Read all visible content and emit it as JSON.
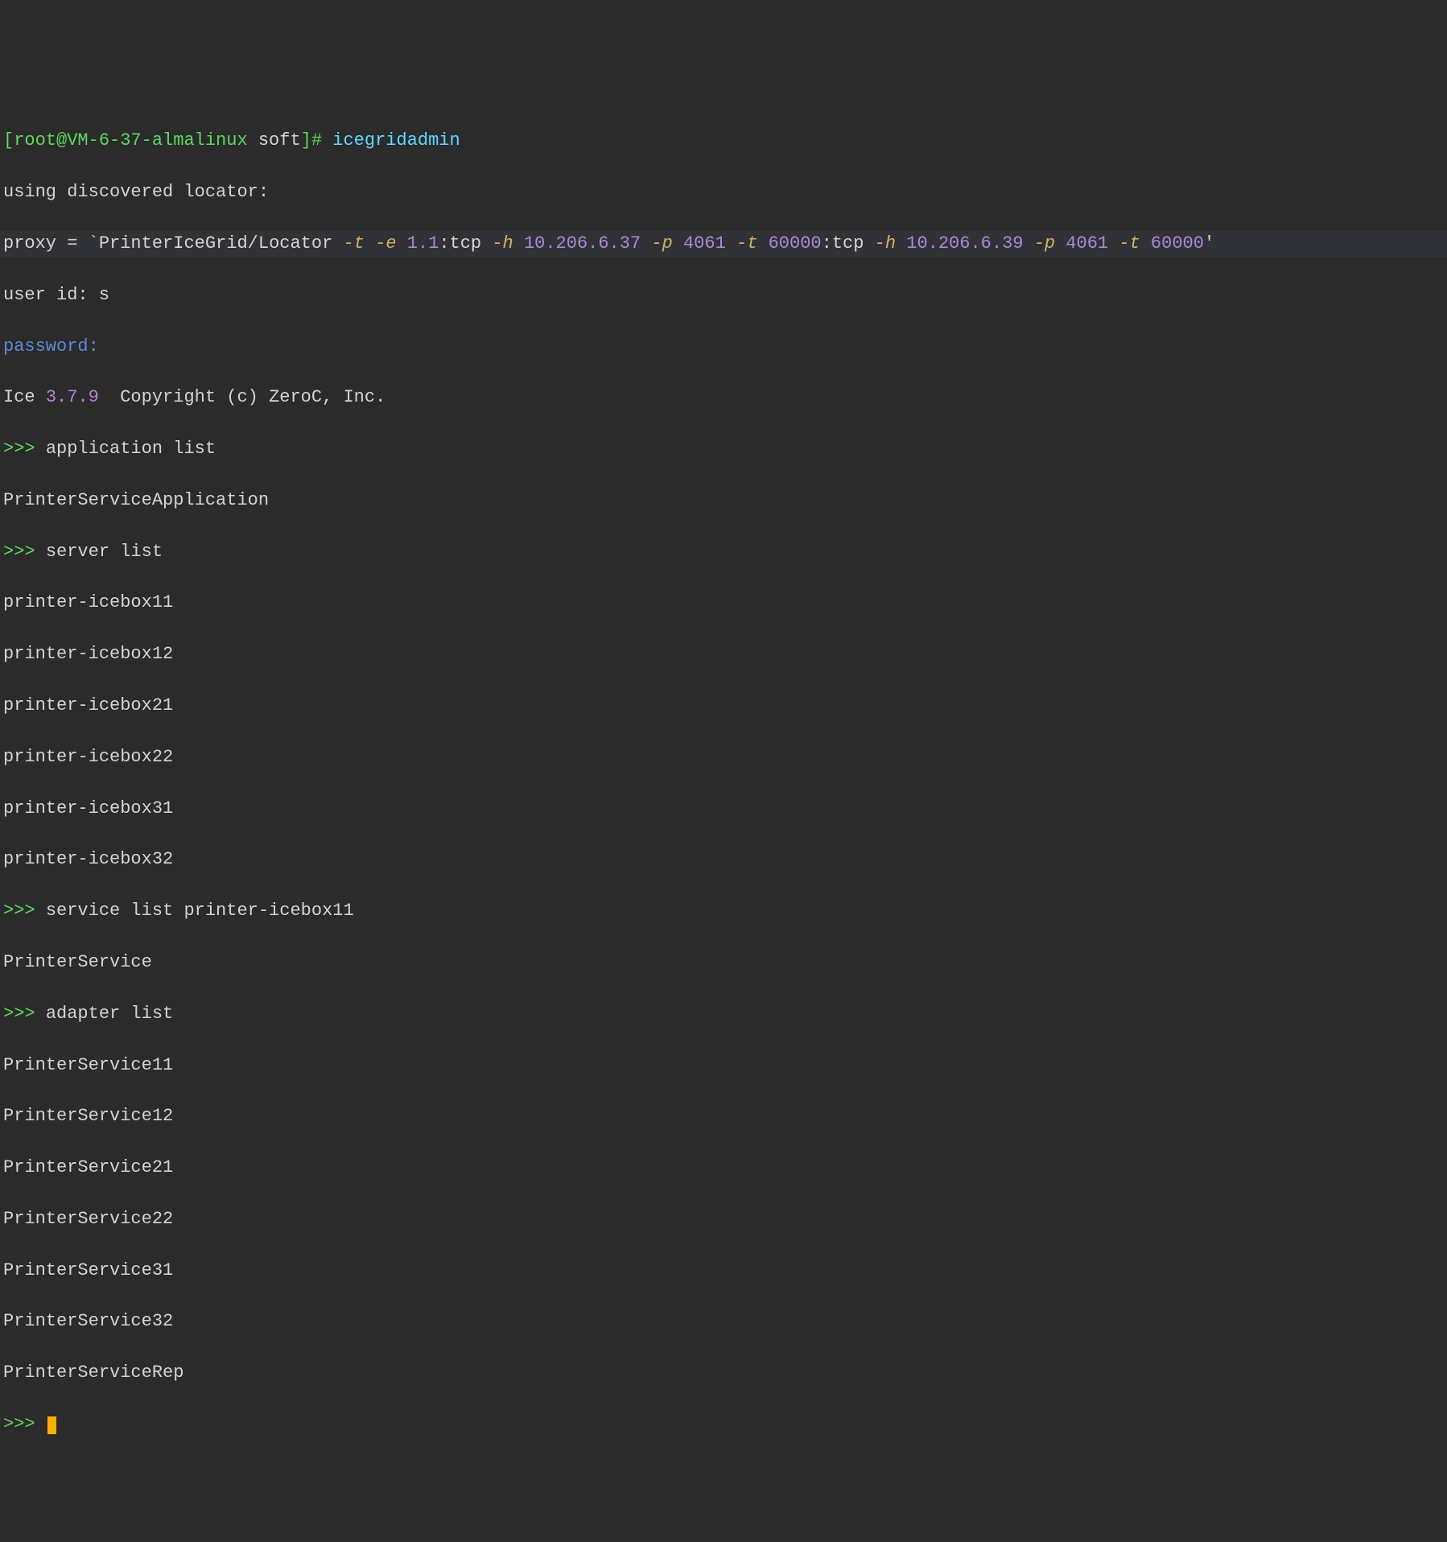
{
  "shell": {
    "prompt_open": "[",
    "user_host": "root@VM-6-37-almalinux",
    "cwd": " soft",
    "prompt_close": "]",
    "hash": "# ",
    "command": "icegridadmin"
  },
  "locator_msg": "using discovered locator:",
  "proxy": {
    "key": "proxy ",
    "eq": "=",
    "tick": " `",
    "name": "PrinterIceGrid/Locator ",
    "flag_t1": "-t ",
    "flag_e": "-e ",
    "ver": "1.1",
    "tcp1": ":tcp ",
    "flag_h1": "-h ",
    "ip1": "10.206.6.37 ",
    "flag_p1": "-p ",
    "port1": "4061 ",
    "flag_t2": "-t ",
    "timeout1": "60000",
    "tcp2": ":tcp ",
    "flag_h2": "-h ",
    "ip2": "10.206.6.39 ",
    "flag_p2": "-p ",
    "port2": "4061 ",
    "flag_t3": "-t ",
    "timeout2": "60000",
    "end_tick": "'"
  },
  "userid": {
    "label": "user id: ",
    "value": "s"
  },
  "password_label": "password:",
  "ice_line": {
    "ice": "Ice ",
    "version": "3.7.9",
    "copyright": "  Copyright (c) ZeroC, Inc."
  },
  "ps": ">>> ",
  "cmds": {
    "app_list": "application list",
    "server_list": "server list",
    "service_list": "service list printer-icebox11",
    "adapter_list": "adapter list"
  },
  "outputs": {
    "app": "PrinterServiceApplication",
    "server1": "printer-icebox11",
    "server2": "printer-icebox12",
    "server3": "printer-icebox21",
    "server4": "printer-icebox22",
    "server5": "printer-icebox31",
    "server6": "printer-icebox32",
    "service": "PrinterService",
    "adapter1": "PrinterService11",
    "adapter2": "PrinterService12",
    "adapter3": "PrinterService21",
    "adapter4": "PrinterService22",
    "adapter5": "PrinterService31",
    "adapter6": "PrinterService32",
    "adapter7": "PrinterServiceRep"
  }
}
